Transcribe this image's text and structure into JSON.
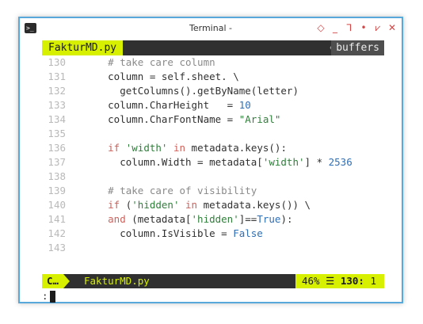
{
  "window": {
    "title": "Terminal -",
    "controls": [
      "◇",
      "_",
      "⅂",
      "•",
      "⩗",
      "✕"
    ]
  },
  "tabline": {
    "active_tab": "FakturMD.py",
    "buffers_label": "buffers"
  },
  "code": {
    "lines": [
      {
        "n": "130",
        "html": "      <span class=\"cm\"># take care column</span>"
      },
      {
        "n": "131",
        "html": "      column = self.sheet. \\"
      },
      {
        "n": "132",
        "html": "        getColumns().getByName(letter)"
      },
      {
        "n": "133",
        "html": "      column.CharHeight   = <span class=\"num\">10</span>"
      },
      {
        "n": "134",
        "html": "      column.CharFontName = <span class=\"str\">\"Arial\"</span>"
      },
      {
        "n": "135",
        "html": ""
      },
      {
        "n": "136",
        "html": "      <span class=\"kw\">if</span> <span class=\"str\">'width'</span> <span class=\"kw\">in</span> metadata.keys():"
      },
      {
        "n": "137",
        "html": "        column.Width = metadata[<span class=\"str\">'width'</span>] * <span class=\"num\">2536</span>"
      },
      {
        "n": "138",
        "html": ""
      },
      {
        "n": "139",
        "html": "      <span class=\"cm\"># take care of visibility</span>"
      },
      {
        "n": "140",
        "html": "      <span class=\"kw\">if</span> (<span class=\"str\">'hidden'</span> <span class=\"kw\">in</span> metadata.keys()) \\"
      },
      {
        "n": "141",
        "html": "      <span class=\"kw\">and</span> (metadata[<span class=\"str\">'hidden'</span>]==<span class=\"num\">True</span>):"
      },
      {
        "n": "142",
        "html": "        column.IsVisible = <span class=\"num\">False</span>"
      },
      {
        "n": "143",
        "html": ""
      }
    ]
  },
  "statusline": {
    "mode": "C…",
    "filename": "FakturMD.py",
    "percent": "46%",
    "line": "130:",
    "column": "1"
  },
  "cmdline": {
    "prompt": ":"
  },
  "colors": {
    "accent": "#d7f000",
    "border": "#58a8dc",
    "statusbar": "#303030"
  }
}
